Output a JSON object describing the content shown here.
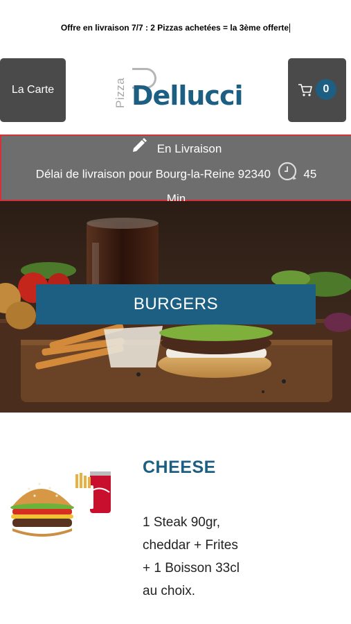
{
  "promo": {
    "text": "Offre en livraison 7/7 : 2 Pizzas achetées = la 3ème offerte"
  },
  "header": {
    "menu_label": "La Carte",
    "cart_count": "0",
    "logo": {
      "small": "Pizza",
      "main": "Dellucci"
    }
  },
  "delivery": {
    "mode": "En Livraison",
    "delay_text": "Délai de livraison pour Bourg-la-Reine 92340",
    "minutes": "45",
    "unit": "Min"
  },
  "category": {
    "title": "BURGERS"
  },
  "product": {
    "title": "CHEESE",
    "description_lines": [
      "1 Steak 90gr,",
      "cheddar  + Frites",
      "+ 1 Boisson 33cl",
      "au choix."
    ]
  },
  "colors": {
    "brand": "#1d5f82",
    "button": "#4a4a4a",
    "delivery_bg": "#6e6e6e",
    "delivery_border": "#d3323a"
  }
}
